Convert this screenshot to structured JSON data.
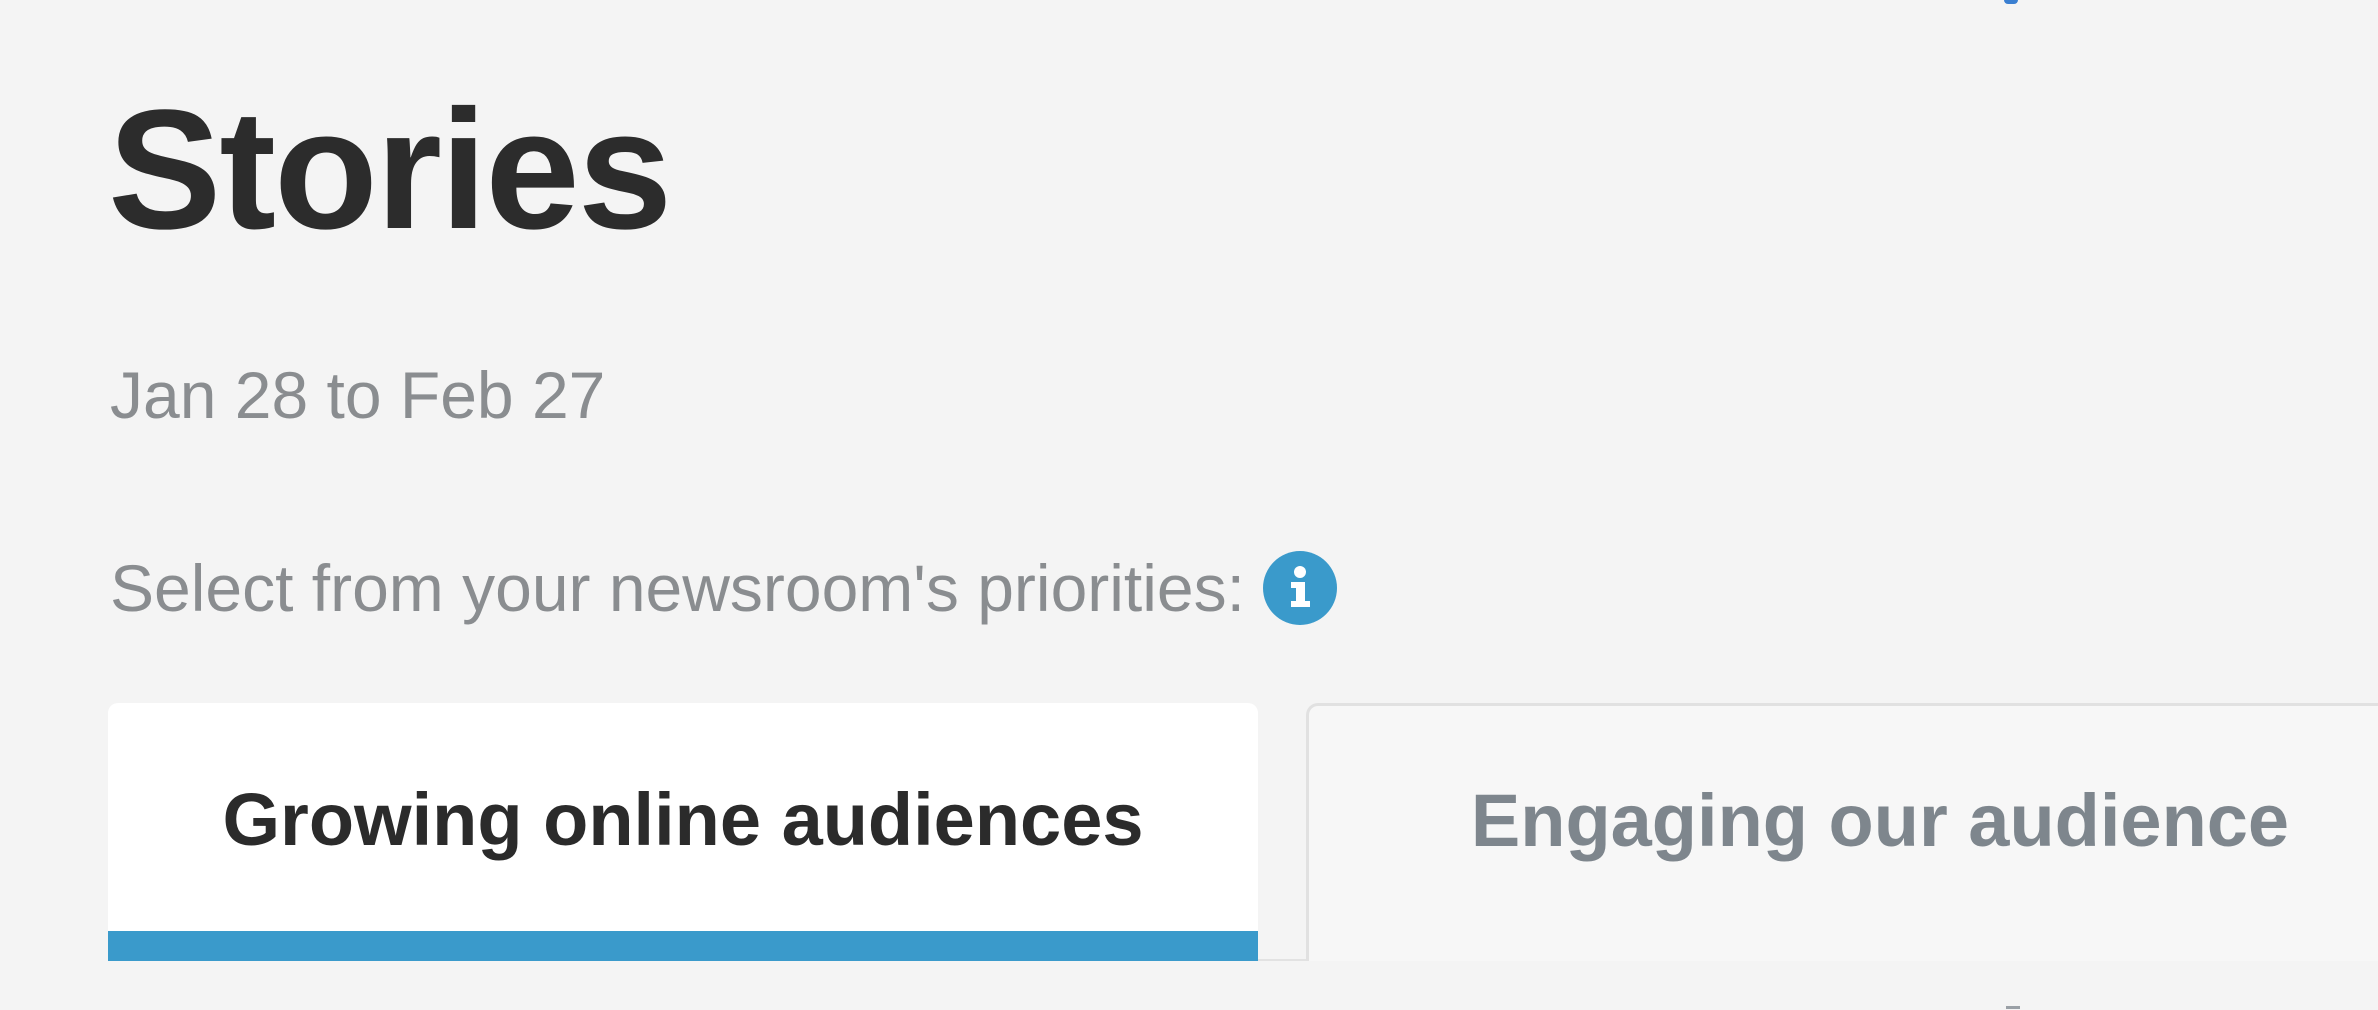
{
  "page": {
    "title": "Stories",
    "date_range": "Jan 28 to Feb 27"
  },
  "priorities": {
    "label": "Select from your newsroom's priorities:",
    "info_icon": "info-icon"
  },
  "tabs": [
    {
      "label": "Growing online audiences",
      "active": true
    },
    {
      "label": "Engaging our audience",
      "active": false
    }
  ],
  "colors": {
    "background": "#f4f4f4",
    "accent": "#3a9acb",
    "title_text": "#2c2c2c",
    "muted_text": "#8a8d90",
    "inactive_tab_text": "#7e868d"
  }
}
